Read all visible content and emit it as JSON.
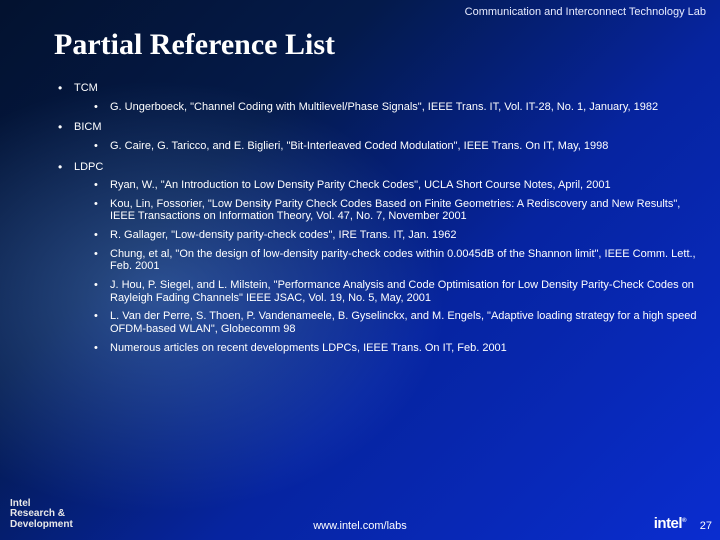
{
  "header": {
    "lab": "Communication and Interconnect Technology Lab"
  },
  "title": "Partial Reference List",
  "sections": [
    {
      "label": "TCM",
      "items": [
        "G. Ungerboeck, \"Channel Coding with Multilevel/Phase Signals\", IEEE Trans. IT, Vol. IT-28, No. 1, January, 1982"
      ]
    },
    {
      "label": "BICM",
      "items": [
        "G. Caire, G. Taricco, and E. Biglieri, \"Bit-Interleaved Coded Modulation\", IEEE Trans. On IT, May, 1998"
      ]
    },
    {
      "label": "LDPC",
      "items": [
        "Ryan, W., \"An Introduction to Low Density Parity Check Codes\", UCLA Short Course Notes, April, 2001",
        "Kou, Lin, Fossorier, \"Low Density Parity Check Codes Based on Finite Geometries: A Rediscovery and New Results\", IEEE Transactions on Information Theory, Vol. 47, No. 7, November 2001",
        "R. Gallager, \"Low-density parity-check codes\", IRE Trans. IT, Jan. 1962",
        "Chung, et al, \"On the design of low-density parity-check codes within 0.0045dB of the Shannon limit\", IEEE Comm. Lett., Feb. 2001",
        "J. Hou, P. Siegel, and L. Milstein, \"Performance Analysis and Code Optimisation for Low Density Parity-Check Codes on Rayleigh Fading Channels\" IEEE JSAC, Vol. 19, No. 5, May, 2001",
        "L. Van der Perre, S. Thoen, P. Vandenameele, B. Gyselinckx, and M. Engels, \"Adaptive loading strategy for a high speed OFDM-based WLAN\", Globecomm 98",
        "Numerous articles on recent developments LDPCs, IEEE Trans. On IT, Feb. 2001"
      ]
    }
  ],
  "footer": {
    "org_line1": "Intel",
    "org_line2": "Research &",
    "org_line3": "Development",
    "url": "www.intel.com/labs",
    "logo": "intel",
    "reg": "®",
    "page": "27"
  }
}
